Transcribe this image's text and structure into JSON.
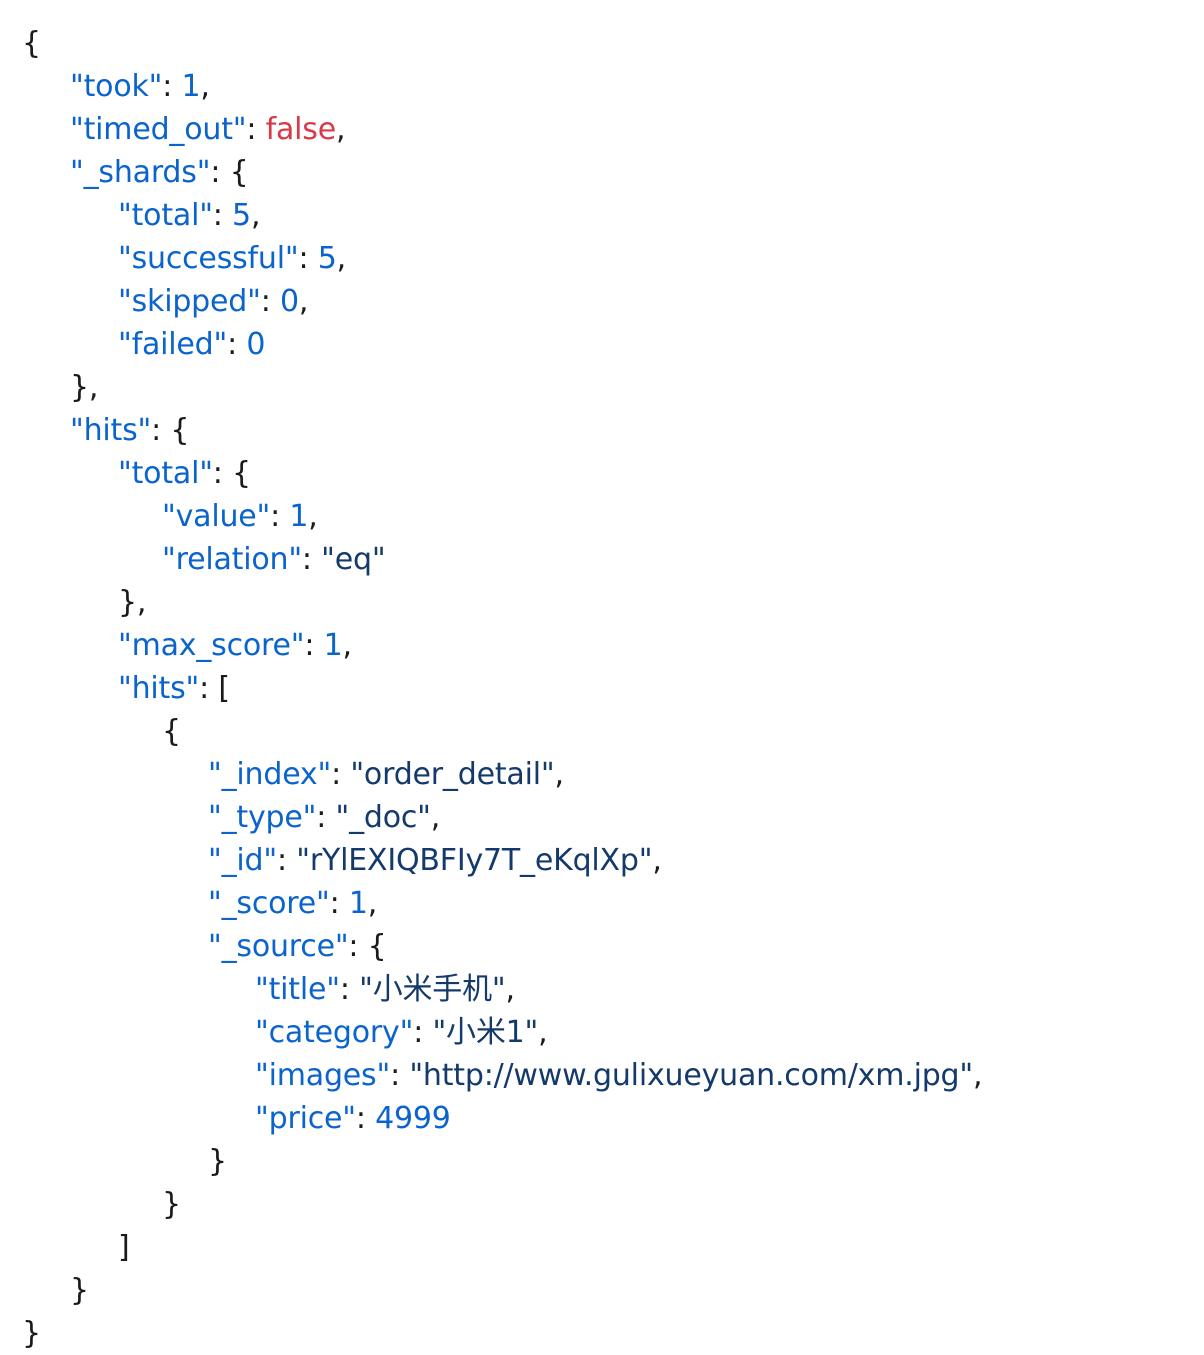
{
  "document": {
    "format": "json",
    "colors": {
      "key": "#0B64CE",
      "string_value": "#143A6B",
      "number": "#0B64CE",
      "boolean": "#D83A48",
      "punctuation": "#1A1A1A",
      "background": "#FFFFFF"
    },
    "lines": [
      {
        "indent": 0,
        "parts": [
          {
            "t": "brace",
            "v": "{"
          }
        ]
      },
      {
        "indent": 1,
        "parts": [
          {
            "t": "key",
            "v": "\"took\""
          },
          {
            "t": "punct",
            "v": ": "
          },
          {
            "t": "num",
            "v": "1"
          },
          {
            "t": "punct",
            "v": ","
          }
        ]
      },
      {
        "indent": 1,
        "parts": [
          {
            "t": "key",
            "v": "\"timed_out\""
          },
          {
            "t": "punct",
            "v": ": "
          },
          {
            "t": "bool",
            "v": "false"
          },
          {
            "t": "punct",
            "v": ","
          }
        ]
      },
      {
        "indent": 1,
        "parts": [
          {
            "t": "key",
            "v": "\"_shards\""
          },
          {
            "t": "punct",
            "v": ": "
          },
          {
            "t": "brace",
            "v": "{"
          }
        ]
      },
      {
        "indent": 2,
        "parts": [
          {
            "t": "key",
            "v": "\"total\""
          },
          {
            "t": "punct",
            "v": ": "
          },
          {
            "t": "num",
            "v": "5"
          },
          {
            "t": "punct",
            "v": ","
          }
        ]
      },
      {
        "indent": 2,
        "parts": [
          {
            "t": "key",
            "v": "\"successful\""
          },
          {
            "t": "punct",
            "v": ": "
          },
          {
            "t": "num",
            "v": "5"
          },
          {
            "t": "punct",
            "v": ","
          }
        ]
      },
      {
        "indent": 2,
        "parts": [
          {
            "t": "key",
            "v": "\"skipped\""
          },
          {
            "t": "punct",
            "v": ": "
          },
          {
            "t": "num",
            "v": "0"
          },
          {
            "t": "punct",
            "v": ","
          }
        ]
      },
      {
        "indent": 2,
        "parts": [
          {
            "t": "key",
            "v": "\"failed\""
          },
          {
            "t": "punct",
            "v": ": "
          },
          {
            "t": "num",
            "v": "0"
          }
        ]
      },
      {
        "indent": 1,
        "parts": [
          {
            "t": "brace",
            "v": "},"
          }
        ]
      },
      {
        "indent": 1,
        "parts": [
          {
            "t": "key",
            "v": "\"hits\""
          },
          {
            "t": "punct",
            "v": ": "
          },
          {
            "t": "brace",
            "v": "{"
          }
        ]
      },
      {
        "indent": 2,
        "parts": [
          {
            "t": "key",
            "v": "\"total\""
          },
          {
            "t": "punct",
            "v": ": "
          },
          {
            "t": "brace",
            "v": "{"
          }
        ]
      },
      {
        "indent": 3,
        "parts": [
          {
            "t": "key",
            "v": "\"value\""
          },
          {
            "t": "punct",
            "v": ": "
          },
          {
            "t": "num",
            "v": "1"
          },
          {
            "t": "punct",
            "v": ","
          }
        ]
      },
      {
        "indent": 3,
        "parts": [
          {
            "t": "key",
            "v": "\"relation\""
          },
          {
            "t": "punct",
            "v": ": "
          },
          {
            "t": "str",
            "v": "\"eq\""
          }
        ]
      },
      {
        "indent": 2,
        "parts": [
          {
            "t": "brace",
            "v": "},"
          }
        ]
      },
      {
        "indent": 2,
        "parts": [
          {
            "t": "key",
            "v": "\"max_score\""
          },
          {
            "t": "punct",
            "v": ": "
          },
          {
            "t": "num",
            "v": "1"
          },
          {
            "t": "punct",
            "v": ","
          }
        ]
      },
      {
        "indent": 2,
        "parts": [
          {
            "t": "key",
            "v": "\"hits\""
          },
          {
            "t": "punct",
            "v": ": "
          },
          {
            "t": "brace",
            "v": "["
          }
        ]
      },
      {
        "indent": 3,
        "parts": [
          {
            "t": "brace",
            "v": "{"
          }
        ]
      },
      {
        "indent": 4,
        "parts": [
          {
            "t": "key",
            "v": "\"_index\""
          },
          {
            "t": "punct",
            "v": ": "
          },
          {
            "t": "str",
            "v": "\"order_detail\""
          },
          {
            "t": "punct",
            "v": ","
          }
        ]
      },
      {
        "indent": 4,
        "parts": [
          {
            "t": "key",
            "v": "\"_type\""
          },
          {
            "t": "punct",
            "v": ": "
          },
          {
            "t": "str",
            "v": "\"_doc\""
          },
          {
            "t": "punct",
            "v": ","
          }
        ]
      },
      {
        "indent": 4,
        "parts": [
          {
            "t": "key",
            "v": "\"_id\""
          },
          {
            "t": "punct",
            "v": ": "
          },
          {
            "t": "str",
            "v": "\"rYlEXIQBFIy7T_eKqlXp\""
          },
          {
            "t": "punct",
            "v": ","
          }
        ]
      },
      {
        "indent": 4,
        "parts": [
          {
            "t": "key",
            "v": "\"_score\""
          },
          {
            "t": "punct",
            "v": ": "
          },
          {
            "t": "num",
            "v": "1"
          },
          {
            "t": "punct",
            "v": ","
          }
        ]
      },
      {
        "indent": 4,
        "parts": [
          {
            "t": "key",
            "v": "\"_source\""
          },
          {
            "t": "punct",
            "v": ": "
          },
          {
            "t": "brace",
            "v": "{"
          }
        ]
      },
      {
        "indent": 5,
        "parts": [
          {
            "t": "key",
            "v": "\"title\""
          },
          {
            "t": "punct",
            "v": ": "
          },
          {
            "t": "str",
            "v": "\"小米手机\""
          },
          {
            "t": "punct",
            "v": ","
          }
        ]
      },
      {
        "indent": 5,
        "parts": [
          {
            "t": "key",
            "v": "\"category\""
          },
          {
            "t": "punct",
            "v": ": "
          },
          {
            "t": "str",
            "v": "\"小米1\""
          },
          {
            "t": "punct",
            "v": ","
          }
        ]
      },
      {
        "indent": 5,
        "parts": [
          {
            "t": "key",
            "v": "\"images\""
          },
          {
            "t": "punct",
            "v": ": "
          },
          {
            "t": "str",
            "v": "\"http://www.gulixueyuan.com/xm.jpg\""
          },
          {
            "t": "punct",
            "v": ","
          }
        ]
      },
      {
        "indent": 5,
        "parts": [
          {
            "t": "key",
            "v": "\"price\""
          },
          {
            "t": "punct",
            "v": ": "
          },
          {
            "t": "num",
            "v": "4999"
          }
        ]
      },
      {
        "indent": 4,
        "parts": [
          {
            "t": "brace",
            "v": "}"
          }
        ]
      },
      {
        "indent": 3,
        "parts": [
          {
            "t": "brace",
            "v": "}"
          }
        ]
      },
      {
        "indent": 2,
        "parts": [
          {
            "t": "brace",
            "v": "]"
          }
        ]
      },
      {
        "indent": 1,
        "parts": [
          {
            "t": "brace",
            "v": "}"
          }
        ]
      },
      {
        "indent": 0,
        "parts": [
          {
            "t": "brace",
            "v": "}"
          }
        ]
      }
    ]
  }
}
